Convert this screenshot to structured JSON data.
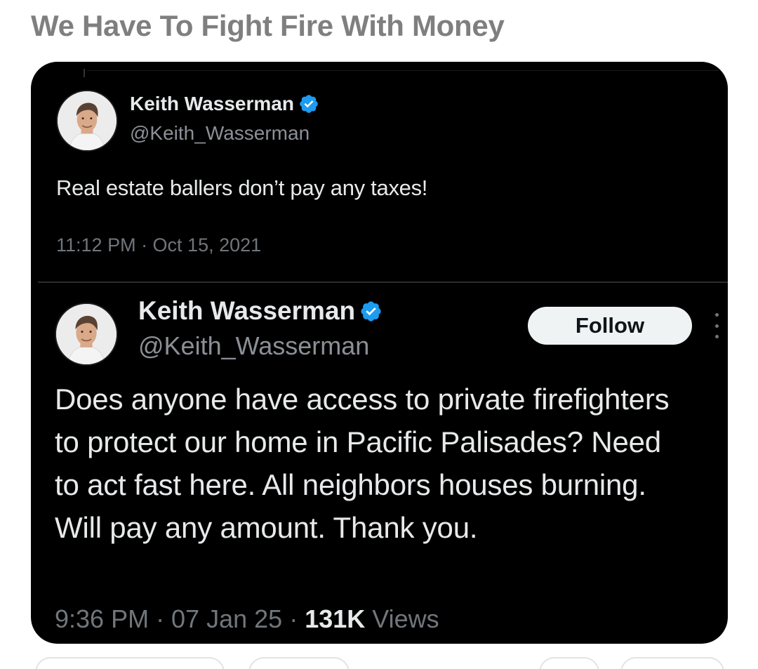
{
  "post": {
    "title": "We Have To Fight Fire With Money"
  },
  "tweets": [
    {
      "author_name": "Keith Wasserman",
      "handle": "@Keith_Wasserman",
      "verified": true,
      "text": "Real estate ballers don’t pay any taxes!",
      "timestamp": "11:12 PM · Oct 15, 2021"
    },
    {
      "author_name": "Keith Wasserman",
      "handle": "@Keith_Wasserman",
      "verified": true,
      "follow_label": "Follow",
      "text": "Does anyone have access to private firefighters to protect our home in Pacific Palisades? Need to act fast here. All neighbors houses burning. Will pay any amount. Thank you.",
      "timestamp": "9:36 PM · 07 Jan 25 · ",
      "views_count": "131K",
      "views_label": " Views"
    }
  ],
  "icons": {
    "verified": "verified-badge-icon",
    "more": "more-vertical-icon",
    "avatar": "avatar-photo"
  },
  "colors": {
    "background": "#000000",
    "text": "#e7e9ea",
    "muted": "#71767b",
    "verified": "#1d9bf0",
    "title": "#7f7f7f"
  }
}
